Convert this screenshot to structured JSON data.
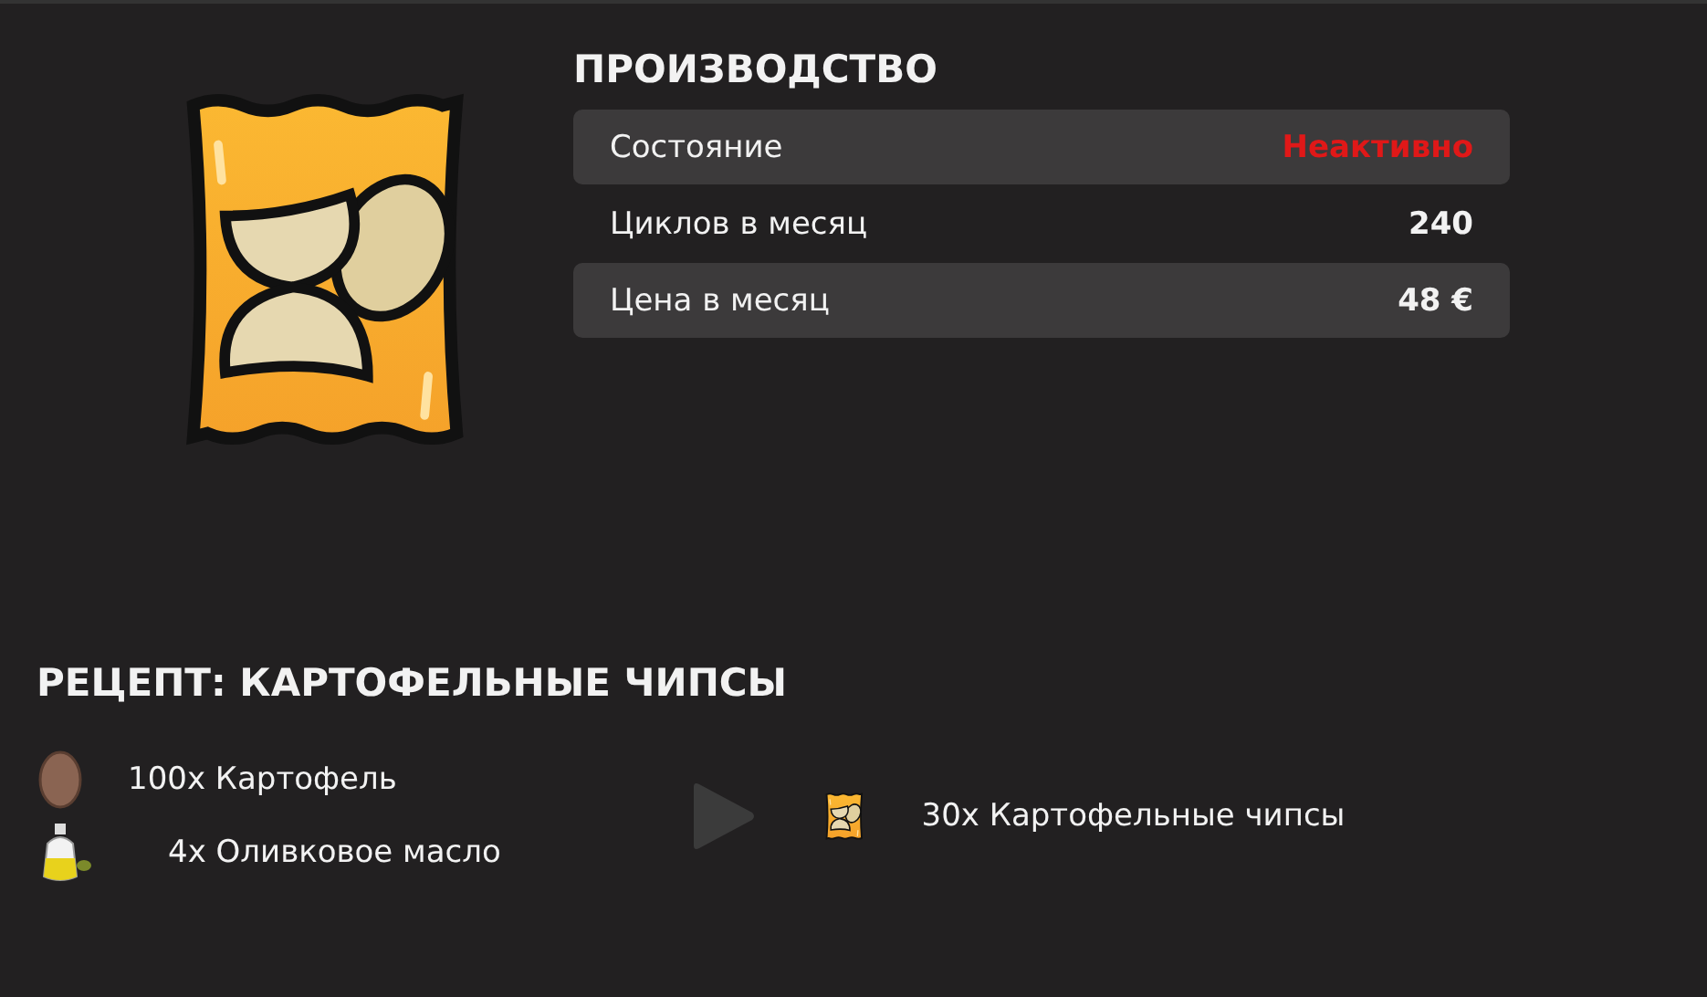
{
  "production": {
    "title": "ПРОИЗВОДСТВО",
    "rows": [
      {
        "kind": "status",
        "label": "Состояние",
        "value": "Неактивно"
      },
      {
        "kind": "plain",
        "label": "Циклов в месяц",
        "value": "240"
      },
      {
        "kind": "plain",
        "label": "Цена в месяц",
        "value": "48 €"
      }
    ]
  },
  "recipe": {
    "title": "РЕЦЕПТ: КАРТОФЕЛЬНЫЕ ЧИПСЫ",
    "inputs": [
      {
        "kind": "potato",
        "text": "100x Картофель"
      },
      {
        "kind": "oil",
        "text": "4x Оливковое масло"
      }
    ],
    "output": {
      "kind": "chips",
      "text": "30x Картофельные чипсы"
    }
  }
}
